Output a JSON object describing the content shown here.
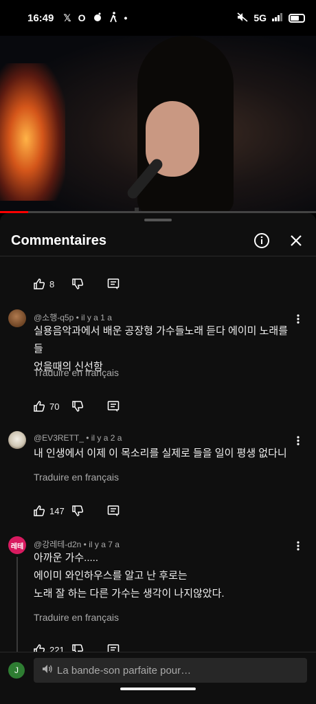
{
  "status": {
    "time": "16:49",
    "left_icons": [
      "x-icon",
      "opera-icon",
      "reddit-icon",
      "walk-icon",
      "dot-icon"
    ],
    "network": "5G",
    "muted": true
  },
  "video": {
    "progress": 0.09
  },
  "panel": {
    "title": "Commentaires"
  },
  "top_actions": {
    "likes": "8"
  },
  "comments": [
    {
      "author": "@소행-q5p",
      "time": "il y a 1 a",
      "text_lines": [
        "실용음악과에서 배운 공장형 가수들노래 듣다 에이미 노래를 들",
        "었을때의 신선함"
      ],
      "translate": "Traduire en français",
      "likes": "70"
    },
    {
      "author": "@EV3RETT_",
      "time": "il y a 2 a",
      "text_lines": [
        "내 인생에서 이제 이 목소리를 실제로 들을 일이 평생 없다니"
      ],
      "translate": "Traduire en français",
      "likes": "147"
    },
    {
      "author": "@강레테-d2n",
      "time": "il y a 7 a",
      "avatar_text": "레테",
      "text_lines": [
        "아까운 가수.....",
        "에이미 와인하우스를 알고 난 후로는",
        "노래 잘 하는 다른 가수는 생각이 나지않았다."
      ],
      "translate": "Traduire en français",
      "likes": "221"
    }
  ],
  "composer": {
    "avatar_letter": "J",
    "placeholder": "La bande-son parfaite pour…"
  },
  "colors": {
    "panel_bg": "#0f0f0f",
    "progress": "#ff0000",
    "avatar_red": "#d81b60",
    "avatar_green": "#2e7d32"
  }
}
